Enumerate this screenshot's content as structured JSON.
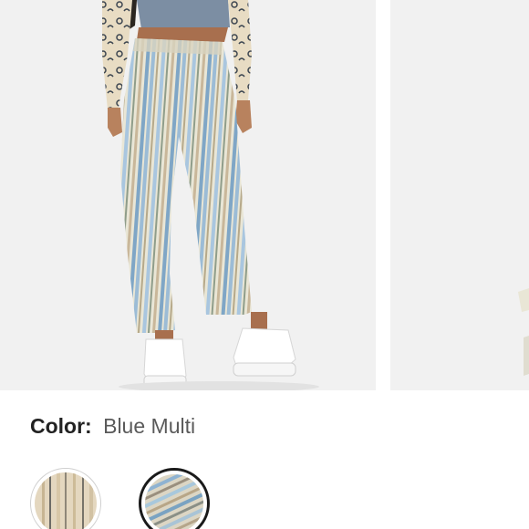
{
  "product": {
    "image_alt_main": "Back view of striped wide-leg pants",
    "image_alt_next": "Next product image"
  },
  "color_selector": {
    "label": "Color:",
    "selected_value": "Blue Multi",
    "swatches": [
      {
        "name": "Tan Multi",
        "selected": false
      },
      {
        "name": "Blue Multi",
        "selected": true
      }
    ]
  },
  "colors": {
    "label_text": "#222222",
    "value_text": "#5a5a5a",
    "image_background": "#f1f1f1",
    "selected_ring": "#1a1a1a"
  }
}
